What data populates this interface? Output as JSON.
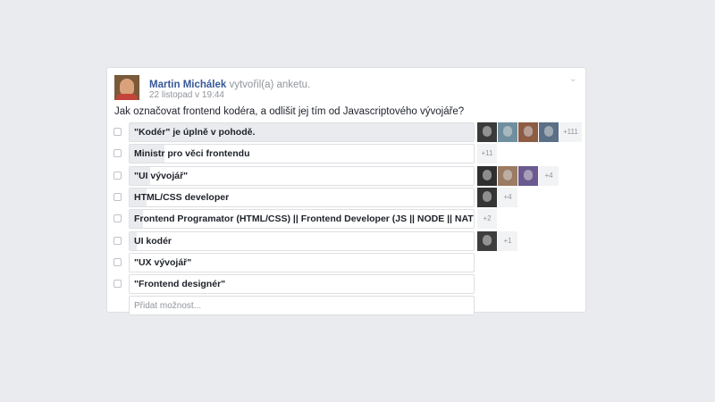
{
  "post": {
    "author": "Martin Michálek",
    "action": " vytvořil(a) anketu.",
    "time": "22 listopad v 19:44",
    "question": "Jak označovat frontend kodéra, a odlišit jej tím od Javascriptového vývojáře?"
  },
  "poll": {
    "options": [
      {
        "label": "\"Kodér\" je úplně v pohodě.",
        "share": 1.0,
        "voter_avatars": [
          "#3a3a3a",
          "#6f8f9f",
          "#8c5c44",
          "#5b6f86"
        ],
        "more": "+111"
      },
      {
        "label": "Ministr pro věci frontendu",
        "share": 0.1,
        "voter_avatars": [],
        "more": "+11"
      },
      {
        "label": "\"UI vývojář\"",
        "share": 0.06,
        "voter_avatars": [
          "#2f2f2f",
          "#9a7b63",
          "#6a5a90"
        ],
        "more": "+4"
      },
      {
        "label": "HTML/CSS developer",
        "share": 0.05,
        "voter_avatars": [
          "#353535"
        ],
        "more": "+4"
      },
      {
        "label": "Frontend Programator (HTML/CSS) || Frontend Developer (JS || NODE || NATIVE)",
        "share": 0.04,
        "voter_avatars": [],
        "more": "+2"
      },
      {
        "label": "UI kodér",
        "share": 0.02,
        "voter_avatars": [
          "#3e3e3e"
        ],
        "more": "+1"
      },
      {
        "label": "\"UX vývojář\"",
        "share": 0.0,
        "voter_avatars": [],
        "more": ""
      },
      {
        "label": "\"Frontend designér\"",
        "share": 0.0,
        "voter_avatars": [],
        "more": ""
      }
    ],
    "add_placeholder": "Přidat možnost..."
  },
  "colors": {
    "link": "#365899",
    "meta": "#90949c",
    "bar_fill": "#e9ebee",
    "border": "#dddfe2"
  },
  "icons": {
    "menu": "chevron-down-icon"
  }
}
